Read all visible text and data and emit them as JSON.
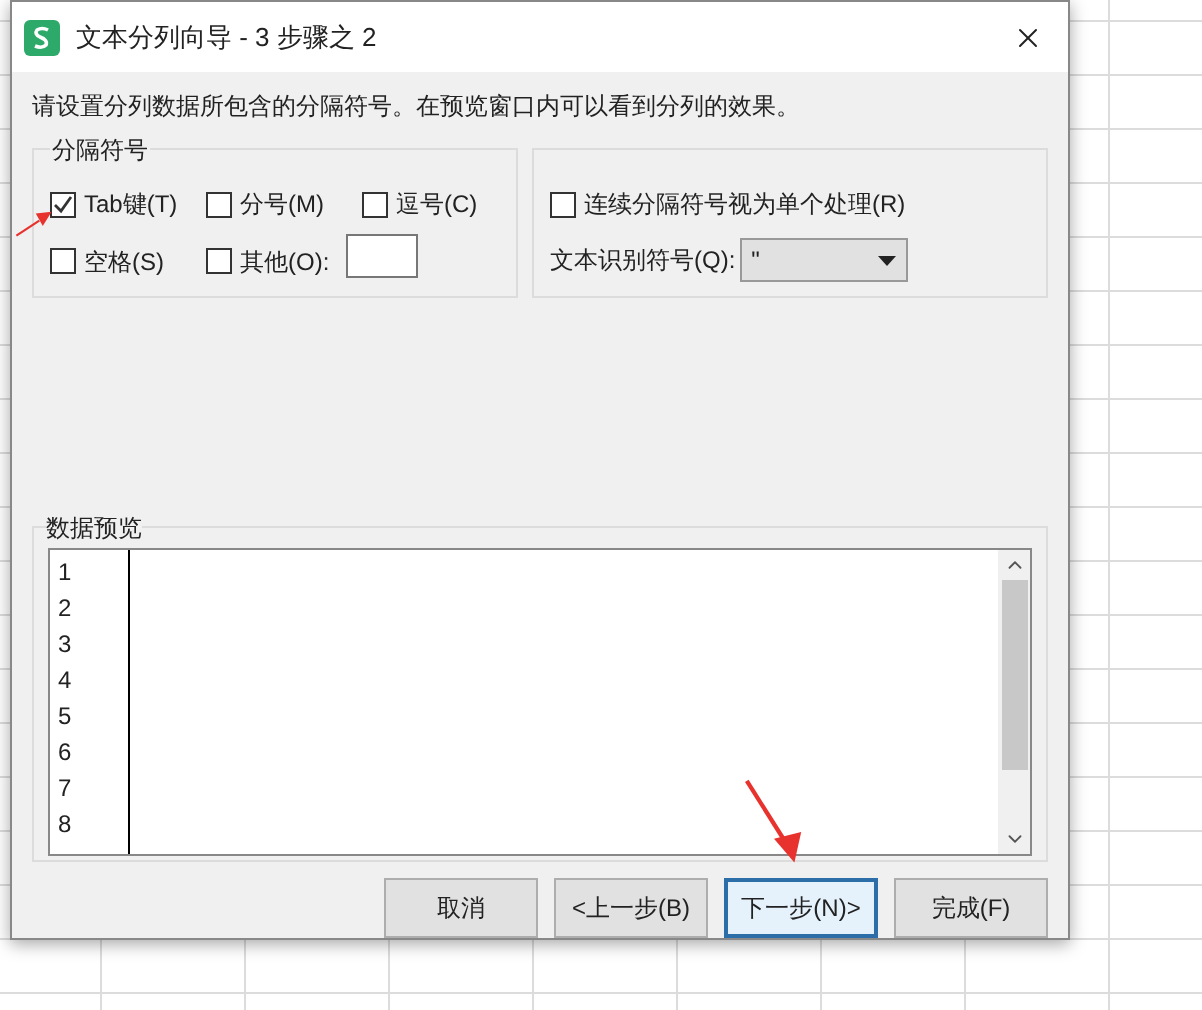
{
  "window": {
    "title": "文本分列向导 - 3 步骤之 2"
  },
  "instruction": "请设置分列数据所包含的分隔符号。在预览窗口内可以看到分列的效果。",
  "delimiters": {
    "title": "分隔符号",
    "options": [
      {
        "label": "Tab键(T)",
        "checked": true
      },
      {
        "label": "分号(M)",
        "checked": false
      },
      {
        "label": "逗号(C)",
        "checked": false
      },
      {
        "label": "空格(S)",
        "checked": false
      },
      {
        "label": "其他(O):",
        "checked": false
      }
    ]
  },
  "consecutive": {
    "label": "连续分隔符号视为单个处理(R)",
    "checked": false
  },
  "text_qualifier": {
    "label": "文本识别符号(Q):",
    "value": "\""
  },
  "preview": {
    "title": "数据预览",
    "rows": [
      "1",
      "2",
      "3",
      "4",
      "5",
      "6",
      "7",
      "8"
    ]
  },
  "buttons": [
    {
      "label": "取消",
      "focused": false
    },
    {
      "label": "<上一步(B)",
      "focused": false
    },
    {
      "label": "下一步(N)>",
      "focused": true
    },
    {
      "label": "完成(F)",
      "focused": false
    }
  ]
}
